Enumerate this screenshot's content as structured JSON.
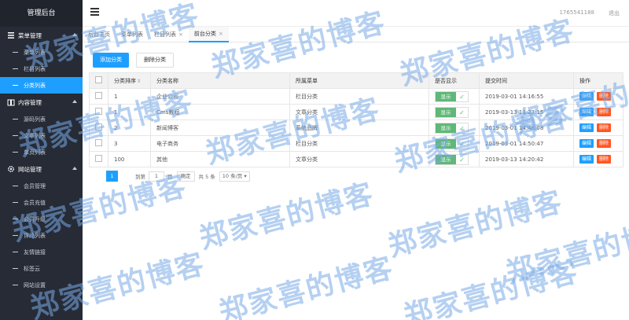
{
  "sidebar": {
    "brand": "管理后台",
    "groups": [
      {
        "label": "菜单管理",
        "icon": "menu-icon",
        "items": [
          "菜单列表",
          "栏目列表",
          "分类列表"
        ]
      },
      {
        "label": "内容管理",
        "icon": "content-icon",
        "items": [
          "源码列表",
          "文章列表",
          "单页列表"
        ]
      },
      {
        "label": "网站管理",
        "icon": "gear-icon",
        "items": [
          "会员管理",
          "会员充值",
          "会员升级",
          "评论列表",
          "友情链接",
          "标签云",
          "网站设置"
        ]
      }
    ],
    "active_item": "分类列表"
  },
  "header": {
    "user": "1765541188",
    "logout": "退出"
  },
  "tabs": [
    {
      "label": "后台主页",
      "closable": false
    },
    {
      "label": "菜单列表",
      "closable": false
    },
    {
      "label": "栏目列表",
      "closable": true
    },
    {
      "label": "前台分类",
      "closable": true,
      "active": true
    }
  ],
  "toolbar": {
    "add_label": "添加分类",
    "delete_label": "删除分类"
  },
  "table": {
    "headers": [
      "分类排序",
      "分类名称",
      "所属菜单",
      "是否显示",
      "提交时间",
      "操作"
    ],
    "rows": [
      {
        "sort": "1",
        "name": "企业公司",
        "menu": "栏目分类",
        "show": "显示",
        "time": "2019-03-01 14:16:55"
      },
      {
        "sort": "1",
        "name": "Cms教程",
        "menu": "文章分类",
        "show": "显示",
        "time": "2019-03-13 13:23:15"
      },
      {
        "sort": "2",
        "name": "新闻博客",
        "menu": "系统品牌",
        "show": "显示",
        "time": "2019-03-01 14:48:08"
      },
      {
        "sort": "3",
        "name": "电子商务",
        "menu": "栏目分类",
        "show": "显示",
        "time": "2019-03-01 14:50:47"
      },
      {
        "sort": "100",
        "name": "其他",
        "menu": "文章分类",
        "show": "显示",
        "time": "2019-03-13 14:20:42"
      }
    ],
    "edit_label": "编辑",
    "delete_label": "删除"
  },
  "pager": {
    "current": "1",
    "goto_prefix": "到第",
    "goto_value": "1",
    "goto_suffix": "页",
    "confirm": "确定",
    "total": "共 5 条",
    "page_size": "10 条/页"
  },
  "watermark": "郑家喜的博客",
  "colors": {
    "accent": "#1e9fff",
    "sidebar": "#262b36",
    "success": "#5fb878",
    "danger": "#ff5722"
  }
}
